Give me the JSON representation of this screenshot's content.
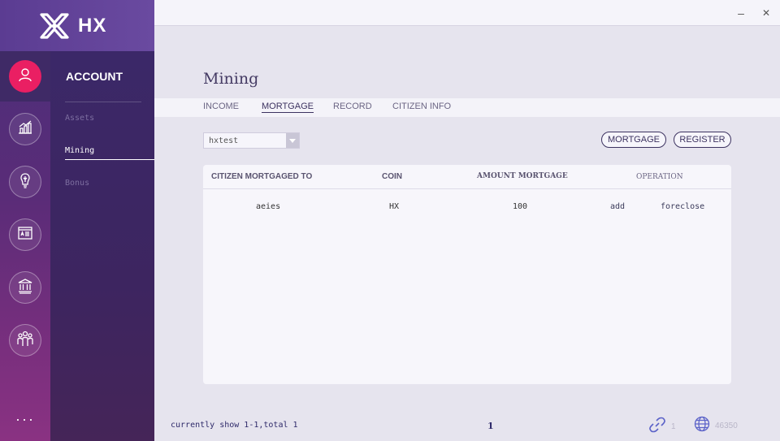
{
  "app": {
    "logo_text": "HX"
  },
  "window": {
    "minimize": "–",
    "close": "✕"
  },
  "rail": {
    "icons": [
      "user-icon",
      "chart-icon",
      "bulb-icon",
      "card-icon",
      "bank-icon",
      "people-icon"
    ],
    "more": "···"
  },
  "sidebar": {
    "title": "ACCOUNT",
    "items": [
      {
        "label": "Assets"
      },
      {
        "label": "Mining"
      },
      {
        "label": "Bonus"
      }
    ]
  },
  "page": {
    "title": "Mining"
  },
  "tabs": [
    {
      "label": "INCOME"
    },
    {
      "label": "MORTGAGE"
    },
    {
      "label": "RECORD"
    },
    {
      "label": "CITIZEN INFO"
    }
  ],
  "account_select": {
    "value": "hxtest"
  },
  "actions": {
    "mortgage": "MORTGAGE",
    "register": "REGISTER"
  },
  "table": {
    "headers": {
      "citizen": "CITIZEN MORTGAGED TO",
      "coin": "COIN",
      "amount": "AMOUNT  MORTGAGE",
      "operation": "OPERATION"
    },
    "rows": [
      {
        "citizen": "aeies",
        "coin": "HX",
        "amount": "100",
        "op_add": "add",
        "op_foreclose": "foreclose"
      }
    ]
  },
  "footer": {
    "summary": "currently show 1-1,total 1",
    "page": "1",
    "connections": "1",
    "block_height": "46350"
  },
  "colors": {
    "accent": "#ea1f63",
    "sidebar": "#3d2560",
    "primary_text": "#3c3260"
  }
}
